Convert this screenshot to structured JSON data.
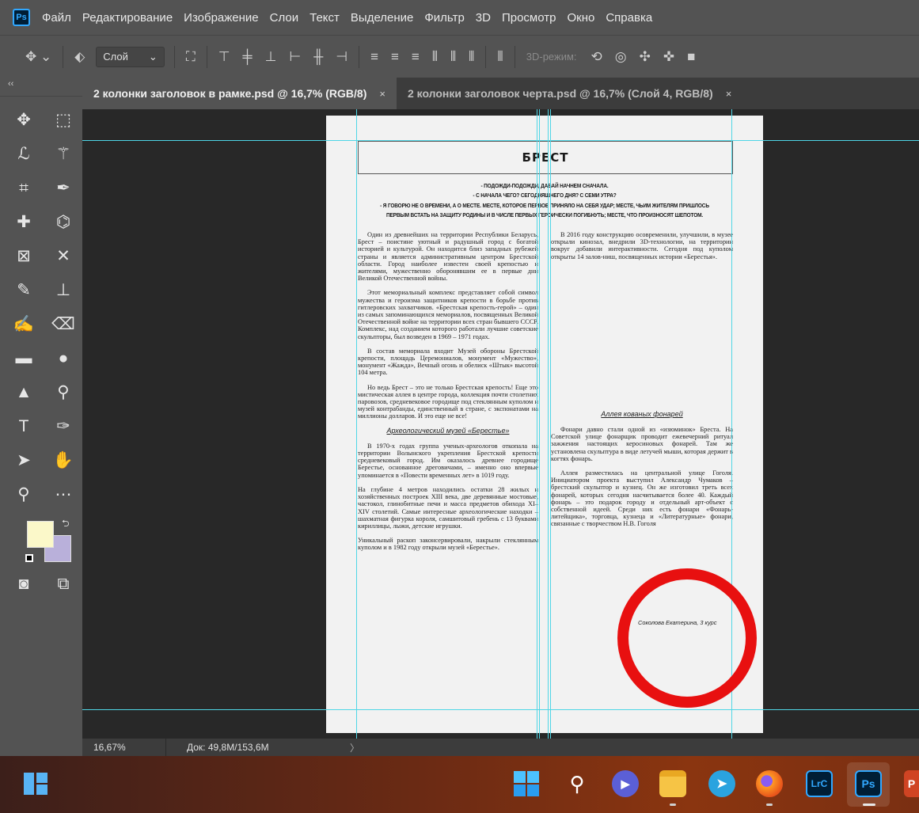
{
  "app": {
    "logo": "Ps",
    "menu": [
      "Файл",
      "Редактирование",
      "Изображение",
      "Слои",
      "Текст",
      "Выделение",
      "Фильтр",
      "3D",
      "Просмотр",
      "Окно",
      "Справка"
    ]
  },
  "options_bar": {
    "move_tool_icon": "move-icon",
    "auto_select_icon": "auto-select-icon",
    "layer_select_value": "Слой",
    "mode_3d_label": "3D-режим:"
  },
  "tabs": [
    {
      "label": "2 колонки заголовок в рамке.psd @ 16,7% (RGB/8)",
      "close": "×"
    },
    {
      "label": "2 колонки заголовок черта.psd @ 16,7% (Слой 4, RGB/8)",
      "close": "×"
    }
  ],
  "toolbar": {
    "collapse": "‹‹",
    "tools": [
      [
        "move-tool-icon",
        "marquee-tool-icon"
      ],
      [
        "lasso-tool-icon",
        "magic-wand-tool-icon"
      ],
      [
        "crop-tool-icon",
        "eyedropper-tool-icon"
      ],
      [
        "healing-brush-tool-icon",
        "patch-tool-icon"
      ],
      [
        "frame-tool-icon",
        "content-aware-move-tool-icon"
      ],
      [
        "brush-tool-icon",
        "clone-stamp-tool-icon"
      ],
      [
        "history-brush-tool-icon",
        "eraser-tool-icon"
      ],
      [
        "gradient-tool-icon",
        "blur-tool-icon"
      ],
      [
        "sharpen-tool-icon",
        "dodge-tool-icon"
      ],
      [
        "type-tool-icon",
        "pen-tool-icon"
      ],
      [
        "path-selection-tool-icon",
        "hand-tool-icon"
      ],
      [
        "zoom-tool-icon",
        "more-tools-icon"
      ]
    ],
    "foreground_color": "#fbf8c9",
    "background_color": "#b9b0da"
  },
  "document": {
    "title": "БРЕСТ",
    "quotes": [
      "- ПОДОЖДИ-ПОДОЖДИ, ДАВАЙ НАЧНЕМ СНАЧАЛА.",
      "- С НАЧАЛА ЧЕГО? СЕГОДНЯШНЕГО ДНЯ? С СЕМИ УТРА?",
      "- Я ГОВОРЮ НЕ О ВРЕМЕНИ, А О МЕСТЕ. МЕСТЕ, КОТОРОЕ ПЕРВОЕ ПРИНЯЛО НА СЕБЯ УДАР; МЕСТЕ, ЧЬИМ ЖИТЕЛЯМ ПРИШЛОСЬ",
      "ПЕРВЫМ ВСТАТЬ НА ЗАЩИТУ РОДИНЫ И В ЧИСЛЕ ПЕРВЫХ ГЕРОИЧЕСКИ ПОГИБНУТЬ; МЕСТЕ, ЧТО ПРОИЗНОСЯТ ШЕПОТОМ."
    ],
    "left_col": {
      "p1": "Один из древнейших на территории Республики Беларусь, Брест – поистине уютный и радушный город с богатой историей и культурой. Он находится близ западных рубежей страны и является административным центром Брестской области. Город наиболее известен своей крепостью и жителями, мужественно оборонявшим ее в первые дни Великой Отечественной войны.",
      "p2": "Этот мемориальный комплекс представляет собой символ мужества и героизма защитников крепости в борьбе против гитлеровских захватчиков. «Брестская крепость-герой» – один из самых запоминающихся мемориалов, посвященных Великой Отечественной войне на территории всех стран бывшего СССР. Комплекс, над созданием которого работали лучшие советские скульпторы, был возведен в 1969 – 1971 годах.",
      "p3": "В состав мемориала входит Музей обороны Брестской крепости, площадь Церемониалов, монумент «Мужество», монумент «Жажда», Вечный огонь и обелиск «Штык» высотой 104 метра.",
      "p4": "Но ведь Брест – это не только Брестская крепость! Еще это мистическая аллея в центре города, коллекция почти столетних паровозов, средневековое городище под стеклянным куполом и музей контрабанды, единственный в стране, с экспонатами на миллионы долларов. И это еще не все!",
      "heading": "Археологический музей «Берестье»",
      "p5": "В 1970-х годах группа ученых-археологов откопала на территории Волынского укрепления Брестской крепости средневековый город. Им оказалось древнее городище Берестье, основанное дреговичами, – именно оно впервые упоминается в «Повести временных лет» в 1019 году.",
      "p6": "На глубине 4 метров находились остатки 28 жилых и хозяйственных построек XIII века, две деревянные мостовые, частокол, глинобитные печи и масса предметов обихода XI–XIV столетий. Самые интересные археологические находки – шахматная фигурка короля, самшитовый гребень с 13 буквами кириллицы, лыжи, детские игрушки.",
      "p7": "Уникальный раскоп законсервировали, накрыли стеклянным куполом и в 1982 году открыли музей «Берестье»."
    },
    "right_col": {
      "p1": "В 2016 году конструкцию осовременили, улучшили, в музее открыли кинозал, внедрили 3D-технологии, на территории вокруг добавили интерактивности. Сегодня под куполом открыты 14 залов-ниш, посвященных истории «Берестья».",
      "heading": "Аллея кованых фонарей",
      "p2": "Фонари давно стали одной из «изюминок» Бреста. На Советской улице фонарщик проводит ежевечерний ритуал зажжения настоящих керосиновых фонарей. Там же установлена скульптура в виде летучей мыши, которая держит в когтях фонарь.",
      "p3": "Аллея разместилась на центральной улице Гоголя. Инициатором проекта выступил Александр Чумаков – брестский скульптор и кузнец. Он же изготовил треть всех фонарей, которых сегодня насчитывается более 40. Каждый фонарь – это подарок городу и отдельный арт-объект с собственной идеей. Среди них есть фонари «Фонарь-литейщика», торговца, кузнеца и «Литературные» фонари, связанные с творчеством Н.В. Гоголя"
    },
    "author": "Соколова Екатерина, 3 курс",
    "annotation_color": "#e81010"
  },
  "status": {
    "zoom": "16,67%",
    "doc_size": "Док: 49,8M/153,6M",
    "arrow": "〉"
  },
  "taskbar": {
    "icons": [
      "windows-start-icon",
      "search-icon",
      "meet-icon",
      "file-explorer-icon",
      "telegram-icon",
      "firefox-icon",
      "lightroom-classic-icon",
      "photoshop-icon",
      "powerpoint-icon"
    ],
    "lrc_label": "LrC",
    "ps_label": "Ps"
  }
}
